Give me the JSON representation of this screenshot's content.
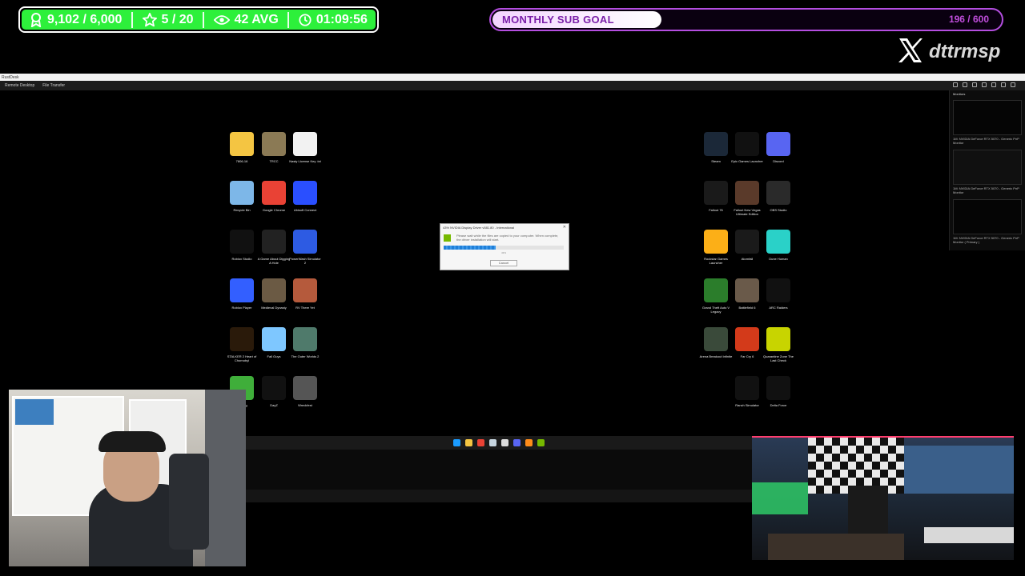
{
  "overlay": {
    "followers": "9,102 / 6,000",
    "stars": "5 / 20",
    "viewers": "42 AVG",
    "uptime": "01:09:56",
    "sub_goal_label": "MONTHLY SUB GOAL",
    "sub_goal_count": "196 / 600",
    "sub_goal_progress": 0.3267,
    "social_handle": "dttrmsp"
  },
  "remote": {
    "toolbar_items": [
      "Remote Desktop",
      "File Transfer"
    ],
    "monitors_title": "Monitors",
    "monitor_labels": [
      "1M: NVIDIA GeForce RTX 5070 - Generic PnP Monitor",
      "1M: NVIDIA GeForce RTX 5070 - Generic PnP Monitor",
      "1M: NVIDIA GeForce RTX 5070 - Generic PnP Monitor ( Primary )"
    ]
  },
  "desktop_icons": [
    {
      "label": "7806-16",
      "icon": "folder-icon",
      "color": "#f4c542"
    },
    {
      "label": "TRCC",
      "icon": "trcc-icon",
      "color": "#8b7a55"
    },
    {
      "label": "Nasty License Key .txt",
      "icon": "text-file-icon",
      "color": "#f2f2f2"
    },
    {
      "label": "Recycle Bin",
      "icon": "recycle-bin-icon",
      "color": "#7db7e8"
    },
    {
      "label": "Google Chrome",
      "icon": "chrome-icon",
      "color": "#e94235"
    },
    {
      "label": "Ubisoft Connect",
      "icon": "ubisoft-icon",
      "color": "#2a4fff"
    },
    {
      "label": "Roblox Studio",
      "icon": "roblox-studio-icon",
      "color": "#111111"
    },
    {
      "label": "A Game About Digging A Hole",
      "icon": "dig-game-icon",
      "color": "#222222"
    },
    {
      "label": "PowerWash Simulator 2",
      "icon": "powerwash-icon",
      "color": "#2d5be3"
    },
    {
      "label": "Roblox Player",
      "icon": "roblox-player-icon",
      "color": "#335fff"
    },
    {
      "label": "Medieval Dynasty",
      "icon": "medieval-icon",
      "color": "#6b5a44"
    },
    {
      "label": "RV There Yet",
      "icon": "rv-icon",
      "color": "#b55a3c"
    },
    {
      "label": "STALKER 2 Heart of Chornobyl",
      "icon": "stalker-icon",
      "color": "#2a1a0a"
    },
    {
      "label": "Fall Guys",
      "icon": "fall-guys-icon",
      "color": "#7ec7ff"
    },
    {
      "label": "The Outer Worlds 2",
      "icon": "outer-worlds-icon",
      "color": "#4f7a6b"
    },
    {
      "label": "Sapling",
      "icon": "sapling-icon",
      "color": "#3fae3a"
    },
    {
      "label": "DayZ",
      "icon": "dayz-icon",
      "color": "#111111"
    },
    {
      "label": "Wreckfest",
      "icon": "wreckfest-icon",
      "color": "#555555"
    },
    {
      "label": "Steam",
      "icon": "steam-icon",
      "color": "#1b2838"
    },
    {
      "label": "Epic Games Launcher",
      "icon": "epic-icon",
      "color": "#111111"
    },
    {
      "label": "Discord",
      "icon": "discord-icon",
      "color": "#5865f2"
    },
    {
      "label": "Fallout 76",
      "icon": "fallout76-icon",
      "color": "#1a1a1a"
    },
    {
      "label": "Fallout New Vegas Ultimate Edition",
      "icon": "fnv-icon",
      "color": "#5a3a2a"
    },
    {
      "label": "OBS Studio",
      "icon": "obs-icon",
      "color": "#2a2a2a"
    },
    {
      "label": "Rockstar Games Launcher",
      "icon": "rockstar-icon",
      "color": "#fcaf17"
    },
    {
      "label": "Atomfall",
      "icon": "atomfall-icon",
      "color": "#1a1a1a"
    },
    {
      "label": "Dune Human",
      "icon": "dune-icon",
      "color": "#2ad1c8"
    },
    {
      "label": "Grand Theft Auto V Legacy",
      "icon": "gta-icon",
      "color": "#2b7d2b"
    },
    {
      "label": "Battlefield 6",
      "icon": "battlefield-icon",
      "color": "#6a5a4a"
    },
    {
      "label": "ARC Raiders",
      "icon": "arc-raiders-icon",
      "color": "#111111"
    },
    {
      "label": "Arena Breakout Infinite",
      "icon": "arena-icon",
      "color": "#3a4a3a"
    },
    {
      "label": "Far Cry 6",
      "icon": "farcry-icon",
      "color": "#d33a1a"
    },
    {
      "label": "Quarantine Zone The Last Check",
      "icon": "quarantine-icon",
      "color": "#c8d400"
    },
    {
      "label": "Ranch Simulator",
      "icon": "ranch-icon",
      "color": "#111111"
    },
    {
      "label": "Delta Force",
      "icon": "delta-force-icon",
      "color": "#111111"
    }
  ],
  "installer": {
    "title": "43% NVIDIA Display Driver v581.80 - International",
    "message": "Please wait while the files are copied to your computer. When complete, the driver installation will start.",
    "progress": 0.43,
    "percent_text": "43%",
    "cancel_label": "Cancel"
  },
  "taskbar_apps": [
    {
      "name": "start-icon",
      "color": "#1a9bff"
    },
    {
      "name": "file-explorer-icon",
      "color": "#f4c542"
    },
    {
      "name": "chrome-taskbar-icon",
      "color": "#e94235"
    },
    {
      "name": "steam-taskbar-icon",
      "color": "#c7d5e0"
    },
    {
      "name": "obs-taskbar-icon",
      "color": "#dddddd"
    },
    {
      "name": "discord-taskbar-icon",
      "color": "#5865f2"
    },
    {
      "name": "app-taskbar-icon",
      "color": "#ff8c1a"
    },
    {
      "name": "nvidia-taskbar-icon",
      "color": "#76b900"
    }
  ]
}
